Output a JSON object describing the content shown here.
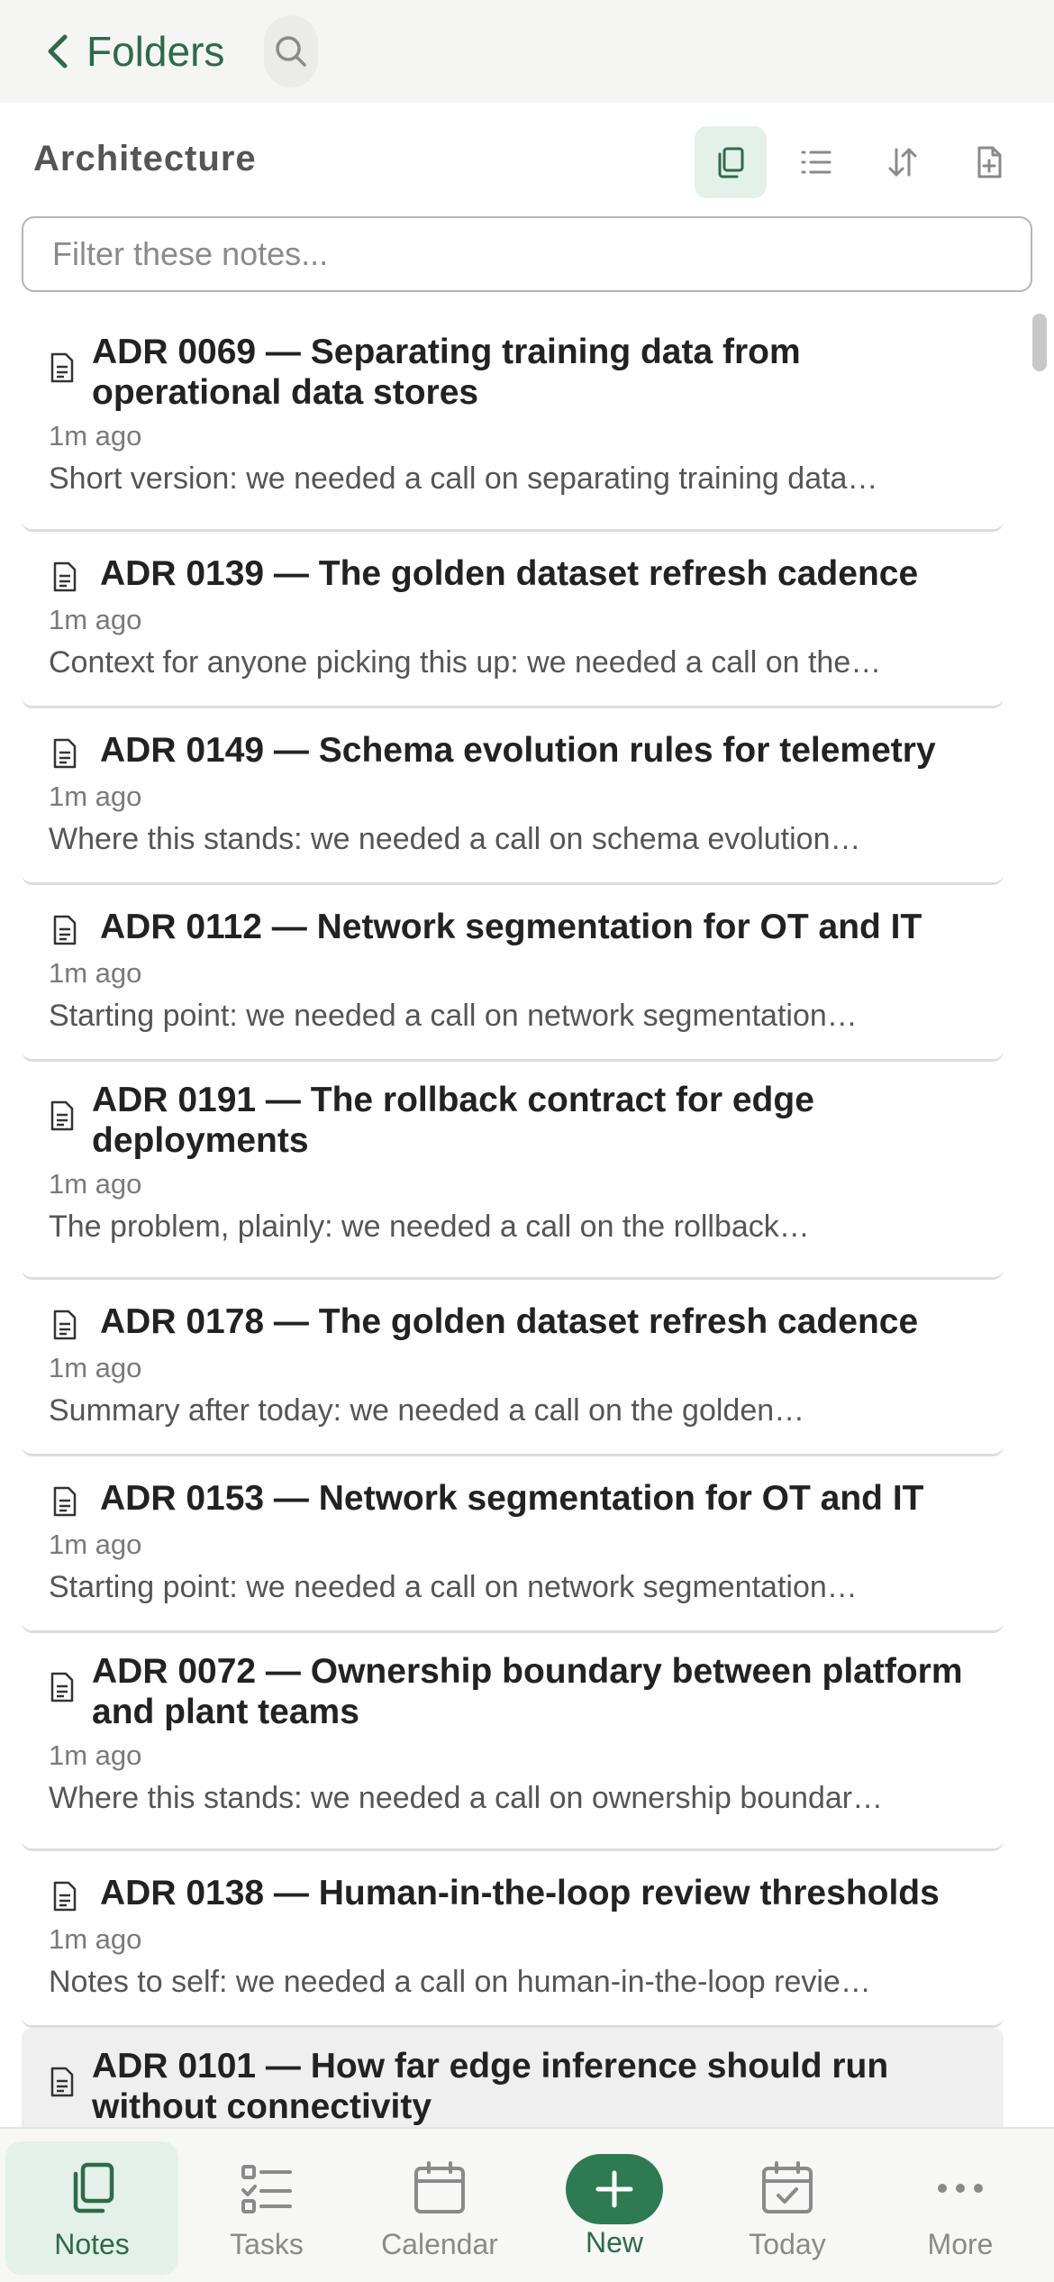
{
  "nav": {
    "back_label": "Folders"
  },
  "folder": {
    "title": "Architecture"
  },
  "filter": {
    "placeholder": "Filter these notes...",
    "value": ""
  },
  "notes": [
    {
      "title": "ADR 0069 — Separating training data from operational data stores",
      "time": "1m ago",
      "snippet": "Short version: we needed a call on separating training data…"
    },
    {
      "title": "ADR 0139 — The golden dataset refresh cadence",
      "time": "1m ago",
      "snippet": "Context for anyone picking this up: we needed a call on the…"
    },
    {
      "title": "ADR 0149 — Schema evolution rules for telemetry",
      "time": "1m ago",
      "snippet": "Where this stands: we needed a call on schema evolution…"
    },
    {
      "title": "ADR 0112 — Network segmentation for OT and IT",
      "time": "1m ago",
      "snippet": "Starting point: we needed a call on network segmentation…"
    },
    {
      "title": "ADR 0191 — The rollback contract for edge deployments",
      "time": "1m ago",
      "snippet": "The problem, plainly: we needed a call on the rollback…"
    },
    {
      "title": "ADR 0178 — The golden dataset refresh cadence",
      "time": "1m ago",
      "snippet": "Summary after today: we needed a call on the golden…"
    },
    {
      "title": "ADR 0153 — Network segmentation for OT and IT",
      "time": "1m ago",
      "snippet": "Starting point: we needed a call on network segmentation…"
    },
    {
      "title": "ADR 0072 — Ownership boundary between platform and plant teams",
      "time": "1m ago",
      "snippet": "Where this stands: we needed a call on ownership boundar…"
    },
    {
      "title": "ADR 0138 — Human-in-the-loop review thresholds",
      "time": "1m ago",
      "snippet": "Notes to self: we needed a call on human-in-the-loop revie…"
    },
    {
      "title": "ADR 0101 — How far edge inference should run without connectivity",
      "time": "",
      "snippet": ""
    }
  ],
  "tabs": {
    "notes": "Notes",
    "tasks": "Tasks",
    "calendar": "Calendar",
    "new": "New",
    "today": "Today",
    "more": "More"
  },
  "colors": {
    "accent": "#2e6a4a",
    "accent_bg": "#e3f1e9",
    "new_button": "#2e7a52"
  }
}
